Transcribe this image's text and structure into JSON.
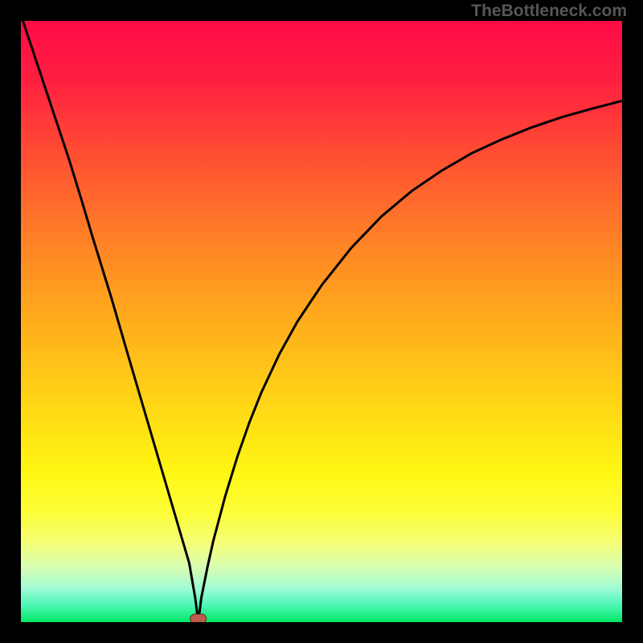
{
  "attribution": "TheBottleneck.com",
  "colors": {
    "background": "#000000",
    "attribution_text": "#565656",
    "gradient_stops": [
      {
        "offset": 0.0,
        "color": "#ff0b47"
      },
      {
        "offset": 0.1,
        "color": "#ff2040"
      },
      {
        "offset": 0.22,
        "color": "#ff4d33"
      },
      {
        "offset": 0.35,
        "color": "#ff7c27"
      },
      {
        "offset": 0.48,
        "color": "#ffa71d"
      },
      {
        "offset": 0.62,
        "color": "#ffd116"
      },
      {
        "offset": 0.75,
        "color": "#fff713"
      },
      {
        "offset": 0.82,
        "color": "#fdfe3a"
      },
      {
        "offset": 0.87,
        "color": "#f3ff7a"
      },
      {
        "offset": 0.91,
        "color": "#d7feb4"
      },
      {
        "offset": 0.945,
        "color": "#9dfbd5"
      },
      {
        "offset": 0.97,
        "color": "#52f7b9"
      },
      {
        "offset": 1.0,
        "color": "#00e865"
      }
    ],
    "curve": "#000000",
    "marker_fill": "#c05a4a",
    "marker_stroke": "#5a2a22"
  },
  "chart_data": {
    "type": "line",
    "title": "",
    "xlabel": "",
    "ylabel": "",
    "xlim": [
      0,
      100
    ],
    "ylim": [
      0,
      100
    ],
    "grid": false,
    "minimum_point": {
      "x": 29.5,
      "y": 0
    },
    "series": [
      {
        "name": "curve",
        "x": [
          0,
          2,
          5,
          8,
          10,
          12,
          15,
          18,
          20,
          22,
          24,
          26,
          27,
          28,
          29,
          29.5,
          30,
          31,
          32,
          34,
          36,
          38,
          40,
          43,
          46,
          50,
          55,
          60,
          65,
          70,
          75,
          80,
          85,
          90,
          95,
          100
        ],
        "values": [
          101,
          95,
          86,
          77,
          70.5,
          63.8,
          54.1,
          43.8,
          37,
          30.2,
          23.4,
          16.6,
          13.2,
          9.8,
          4.0,
          0.0,
          4.0,
          9.0,
          13.5,
          21.0,
          27.5,
          33.2,
          38.2,
          44.6,
          50.0,
          56.0,
          62.3,
          67.5,
          71.7,
          75.1,
          78.0,
          80.3,
          82.3,
          84.0,
          85.4,
          86.7
        ]
      }
    ]
  }
}
